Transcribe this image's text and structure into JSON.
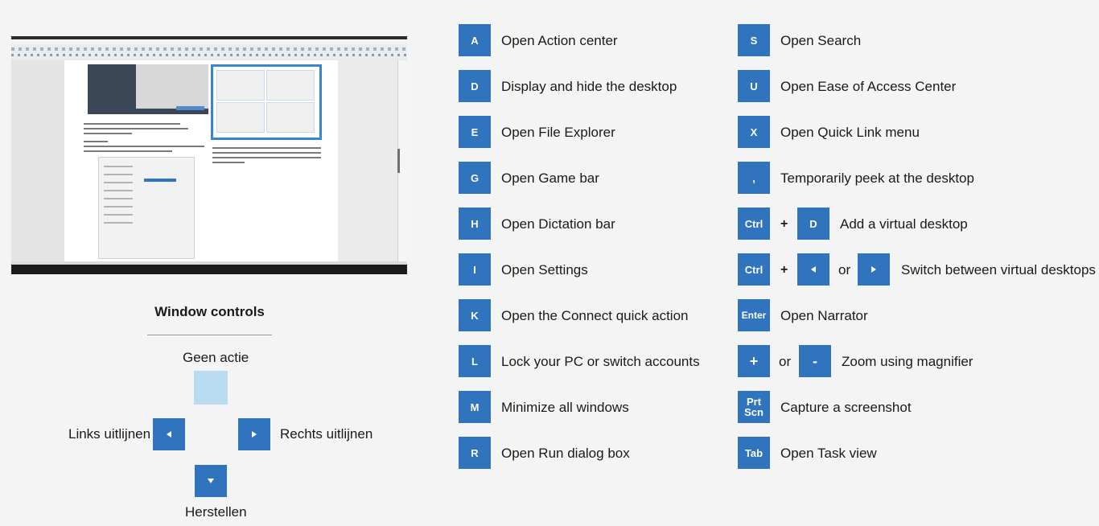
{
  "shortcuts_col1": [
    {
      "key": "A",
      "label": "Open Action center"
    },
    {
      "key": "D",
      "label": "Display and hide the desktop"
    },
    {
      "key": "E",
      "label": "Open File Explorer"
    },
    {
      "key": "G",
      "label": "Open Game bar"
    },
    {
      "key": "H",
      "label": "Open Dictation bar"
    },
    {
      "key": "I",
      "label": "Open Settings"
    },
    {
      "key": "K",
      "label": "Open the Connect quick action"
    },
    {
      "key": "L",
      "label": "Lock your PC or switch accounts"
    },
    {
      "key": "M",
      "label": "Minimize all windows"
    },
    {
      "key": "R",
      "label": "Open Run dialog box"
    }
  ],
  "shortcuts_col2": {
    "s": {
      "key": "S",
      "label": "Open Search"
    },
    "u": {
      "key": "U",
      "label": "Open Ease of Access Center"
    },
    "x": {
      "key": "X",
      "label": "Open Quick Link menu"
    },
    "comma": {
      "key": ",",
      "label": "Temporarily peek at the desktop"
    },
    "ctrl_d": {
      "key1": "Ctrl",
      "plus": "+",
      "key2": "D",
      "label": "Add a virtual desktop"
    },
    "ctrl_arrows": {
      "key1": "Ctrl",
      "plus": "+",
      "or": "or",
      "label": "Switch between virtual desktops"
    },
    "enter": {
      "key": "Enter",
      "label": "Open Narrator"
    },
    "zoom": {
      "key1": "+",
      "or": "or",
      "key2": "-",
      "label": "Zoom using magnifier"
    },
    "prtscn": {
      "key_line1": "Prt",
      "key_line2": "Scn",
      "label": "Capture a screenshot"
    },
    "tab": {
      "key": "Tab",
      "label": "Open Task view"
    }
  },
  "window_controls": {
    "title": "Window controls",
    "up_label": "Geen actie",
    "left_label": "Links uitlijnen",
    "right_label": "Rechts uitlijnen",
    "down_label": "Herstellen"
  },
  "colors": {
    "key_blue": "#2f74bc",
    "no_action": "#b9dcf0",
    "background": "#f4f4f4"
  }
}
